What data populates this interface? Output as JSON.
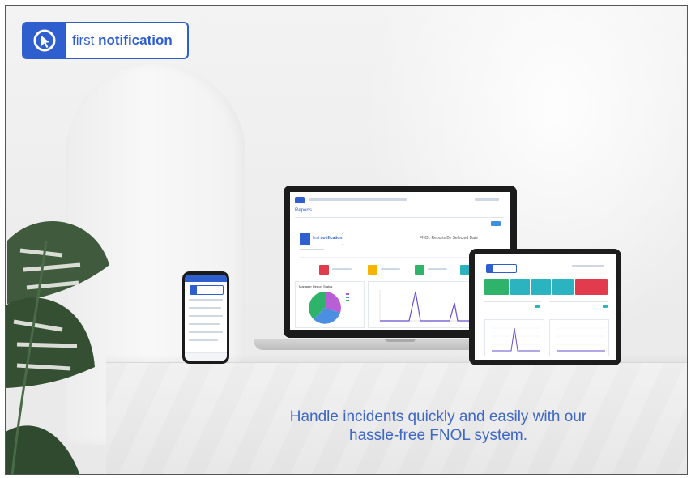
{
  "brand": {
    "name_regular": "first",
    "name_bold": "notification",
    "color": "#2f5fcf"
  },
  "tagline": {
    "line1": "Handle incidents quickly and easily with our",
    "line2": "hassle-free FNOL system."
  },
  "laptop": {
    "page_title": "Reports",
    "report_title": "FNOL Reports By Selected Date",
    "widget_title": "Manager Report Status",
    "tile_colors": [
      "#e23b4e",
      "#f4b400",
      "#2fb36b",
      "#2bb3c0"
    ],
    "pie_colors": [
      "#b85fd6",
      "#4c8fe0",
      "#2fb36b"
    ],
    "chart_line_color": "#6a4fd0"
  },
  "tablet": {
    "tile_colors": [
      "#2fb36b",
      "#2bb3c0",
      "#2bb3c0",
      "#2bb3c0",
      "#e23b4e"
    ]
  },
  "icons": {
    "logo": "first-notification-logo-icon",
    "plant": "monstera-leaf-icon"
  }
}
